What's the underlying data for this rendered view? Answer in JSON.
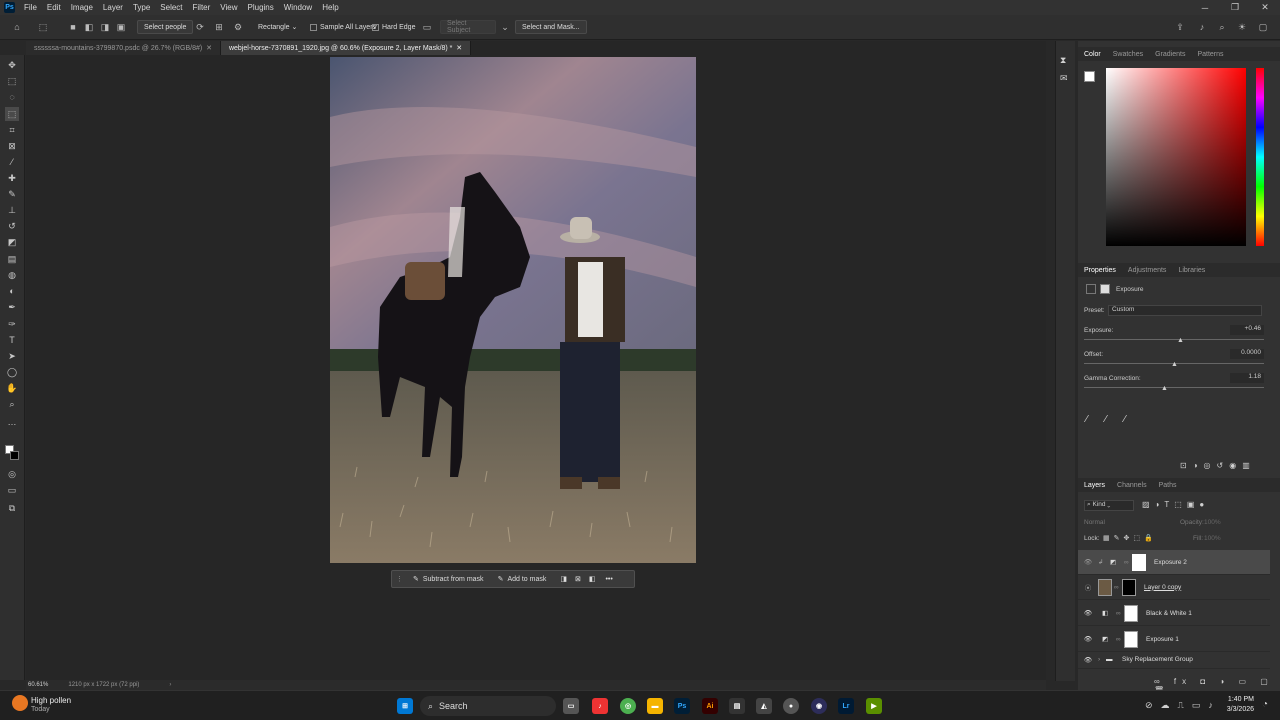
{
  "app": {
    "logo": "Ps"
  },
  "menu": [
    "File",
    "Edit",
    "Image",
    "Layer",
    "Type",
    "Select",
    "Filter",
    "View",
    "Plugins",
    "Window",
    "Help"
  ],
  "options": {
    "select_people": "Select people",
    "shape": "Rectangle",
    "sample_all": "Sample All Layers",
    "hard_edge": "Hard Edge",
    "select_subject": "Select Subject",
    "select_mask": "Select and Mask..."
  },
  "tabs": [
    {
      "label": "ssssssa-mountains-3799870.psdc @ 26.7% (RGB/8#)"
    },
    {
      "label": "webjel-horse-7370891_1920.jpg @ 60.6% (Exposure 2, Layer Mask/8) *"
    }
  ],
  "context_bar": {
    "subtract": "Subtract from mask",
    "add": "Add to mask"
  },
  "status": {
    "zoom": "60.61%",
    "doc_info": "1210 px x 1722 px (72 ppi)"
  },
  "color_panel": {
    "tabs": [
      "Color",
      "Swatches",
      "Gradients",
      "Patterns"
    ]
  },
  "properties_panel": {
    "tabs": [
      "Properties",
      "Adjustments",
      "Libraries"
    ],
    "type": "Exposure",
    "preset_label": "Preset:",
    "preset_value": "Custom",
    "exposure_label": "Exposure:",
    "exposure_value": "+0.46",
    "offset_label": "Offset:",
    "offset_value": "0.0000",
    "gamma_label": "Gamma Correction:",
    "gamma_value": "1.18"
  },
  "layers_panel": {
    "tabs": [
      "Layers",
      "Channels",
      "Paths"
    ],
    "kind": "Kind",
    "blend": "Normal",
    "opacity_label": "Opacity:",
    "opacity": "100%",
    "lock_label": "Lock:",
    "fill_label": "Fill:",
    "fill": "100%",
    "layers": [
      {
        "name": "Exposure 2"
      },
      {
        "name": "Layer 0 copy"
      },
      {
        "name": "Black & White 1"
      },
      {
        "name": "Exposure 1"
      },
      {
        "name": "Sky Replacement Group"
      }
    ]
  },
  "weather": {
    "title": "High pollen",
    "subtitle": "Today"
  },
  "taskbar": {
    "search": "Search",
    "time": "1:40 PM",
    "date": "3/3/2026"
  }
}
